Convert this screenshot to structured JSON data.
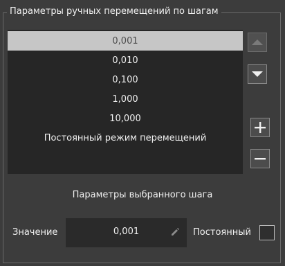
{
  "panel": {
    "title": "Параметры ручных перемещений по шагам"
  },
  "step_list": {
    "items": [
      {
        "label": "0,001",
        "selected": true
      },
      {
        "label": "0,010",
        "selected": false
      },
      {
        "label": "0,100",
        "selected": false
      },
      {
        "label": "1,000",
        "selected": false
      },
      {
        "label": "10,000",
        "selected": false
      },
      {
        "label": "Постоянный режим перемещений",
        "selected": false
      }
    ]
  },
  "buttons": {
    "up": "chevron-up-icon",
    "down": "chevron-down-icon",
    "add": "plus-icon",
    "remove": "minus-icon"
  },
  "selected_step": {
    "heading": "Параметры выбранного шага",
    "value_label": "Значение",
    "value": "0,001",
    "constant_label": "Постоянный",
    "constant_checked": false
  },
  "colors": {
    "background": "#3c3c3c",
    "list_bg": "#262626",
    "selected_row": "#c6c6c6"
  }
}
